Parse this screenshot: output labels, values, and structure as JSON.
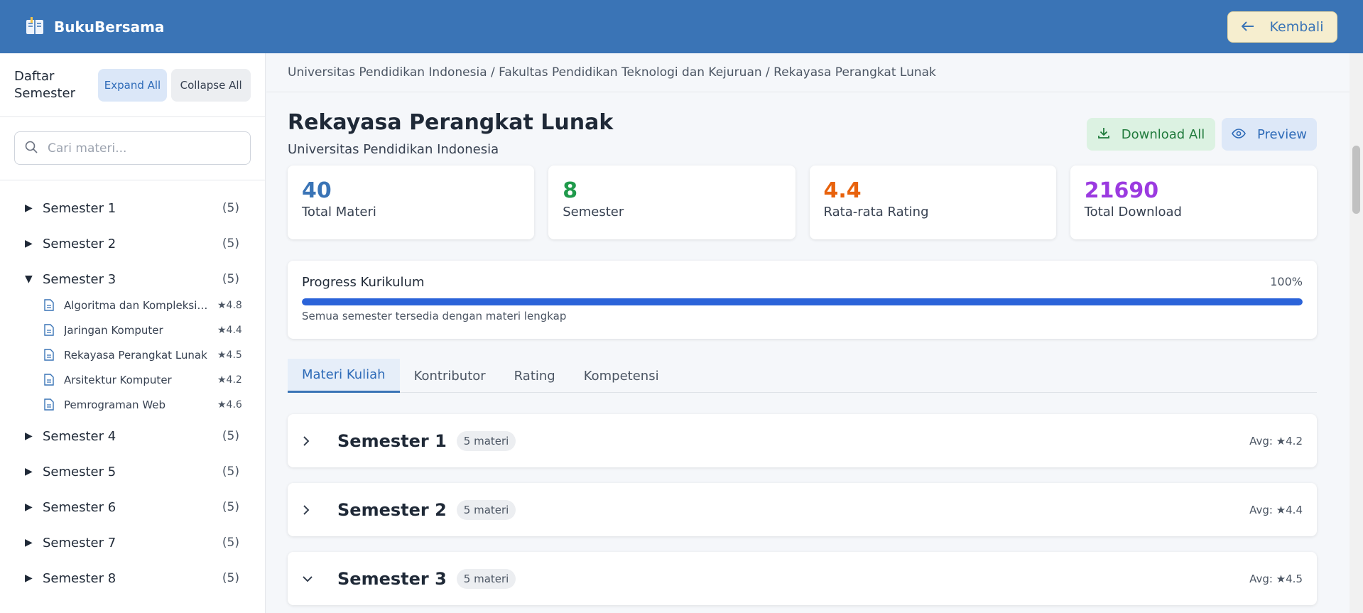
{
  "header": {
    "brand": "BukuBersama",
    "back_label": "Kembali"
  },
  "sidebar": {
    "title": "Daftar Semester",
    "expand_all": "Expand All",
    "collapse_all": "Collapse All",
    "search_placeholder": "Cari materi...",
    "semesters": [
      {
        "label": "Semester 1",
        "count": "(5)",
        "expanded": false
      },
      {
        "label": "Semester 2",
        "count": "(5)",
        "expanded": false
      },
      {
        "label": "Semester 3",
        "count": "(5)",
        "expanded": true
      },
      {
        "label": "Semester 4",
        "count": "(5)",
        "expanded": false
      },
      {
        "label": "Semester 5",
        "count": "(5)",
        "expanded": false
      },
      {
        "label": "Semester 6",
        "count": "(5)",
        "expanded": false
      },
      {
        "label": "Semester 7",
        "count": "(5)",
        "expanded": false
      },
      {
        "label": "Semester 8",
        "count": "(5)",
        "expanded": false
      }
    ],
    "semester3_items": [
      {
        "name": "Algoritma dan Kompleksitas",
        "rating": "★4.8"
      },
      {
        "name": "Jaringan Komputer",
        "rating": "★4.4"
      },
      {
        "name": "Rekayasa Perangkat Lunak",
        "rating": "★4.5"
      },
      {
        "name": "Arsitektur Komputer",
        "rating": "★4.2"
      },
      {
        "name": "Pemrograman Web",
        "rating": "★4.6"
      }
    ]
  },
  "breadcrumb": "Universitas Pendidikan Indonesia / Fakultas Pendidikan Teknologi dan Kejuruan / Rekayasa Perangkat Lunak",
  "page": {
    "title": "Rekayasa Perangkat Lunak",
    "subtitle": "Universitas Pendidikan Indonesia",
    "download_all": "Download All",
    "preview": "Preview"
  },
  "stats": [
    {
      "value": "40",
      "label": "Total Materi",
      "color": "#3a74b6"
    },
    {
      "value": "8",
      "label": "Semester",
      "color": "#1f9a4b"
    },
    {
      "value": "4.4",
      "label": "Rata-rata Rating",
      "color": "#e8620c"
    },
    {
      "value": "21690",
      "label": "Total Download",
      "color": "#9b3ae0"
    }
  ],
  "progress": {
    "label": "Progress Kurikulum",
    "percent_text": "100%",
    "fraction": 1.0,
    "note": "Semua semester tersedia dengan materi lengkap"
  },
  "tabs": [
    "Materi Kuliah",
    "Kontributor",
    "Rating",
    "Kompetensi"
  ],
  "semester_cards": [
    {
      "title": "Semester 1",
      "badge": "5 materi",
      "avg": "Avg: ★4.2",
      "expanded": false
    },
    {
      "title": "Semester 2",
      "badge": "5 materi",
      "avg": "Avg: ★4.4",
      "expanded": false
    },
    {
      "title": "Semester 3",
      "badge": "5 materi",
      "avg": "Avg: ★4.5",
      "expanded": true
    }
  ],
  "colors": {
    "header_bg": "#3a74b6",
    "accent": "#2e6bb8",
    "progress_fill": "#2b63d9"
  }
}
